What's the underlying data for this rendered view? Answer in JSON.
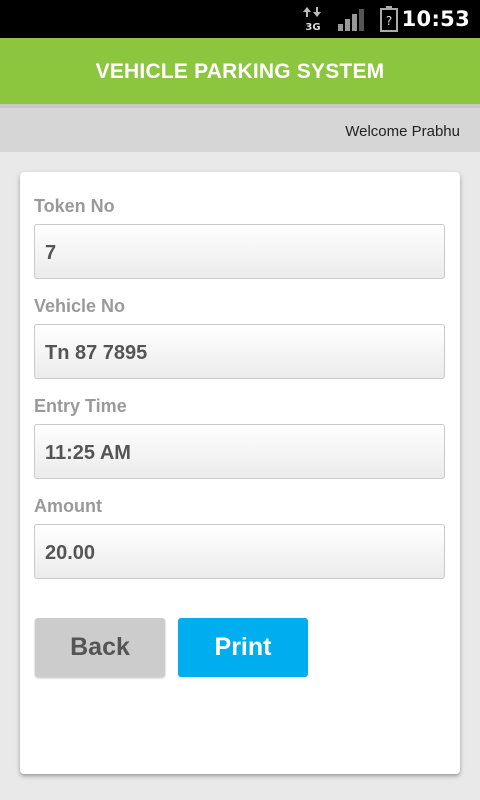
{
  "status_bar": {
    "network_type": "3G",
    "battery_status": "?",
    "time": "10:53",
    "icons": [
      "data-transfer-icon",
      "signal-icon",
      "battery-icon"
    ]
  },
  "header": {
    "title": "VEHICLE PARKING SYSTEM",
    "color": "#8cc63f"
  },
  "welcome": {
    "text": "Welcome Prabhu"
  },
  "form": {
    "fields": [
      {
        "label": "Token No",
        "value": "7"
      },
      {
        "label": "Vehicle No",
        "value": "Tn 87 7895"
      },
      {
        "label": "Entry Time",
        "value": "11:25 AM"
      },
      {
        "label": "Amount",
        "value": "20.00"
      }
    ]
  },
  "buttons": {
    "back_label": "Back",
    "print_label": "Print",
    "print_color": "#00adef"
  }
}
